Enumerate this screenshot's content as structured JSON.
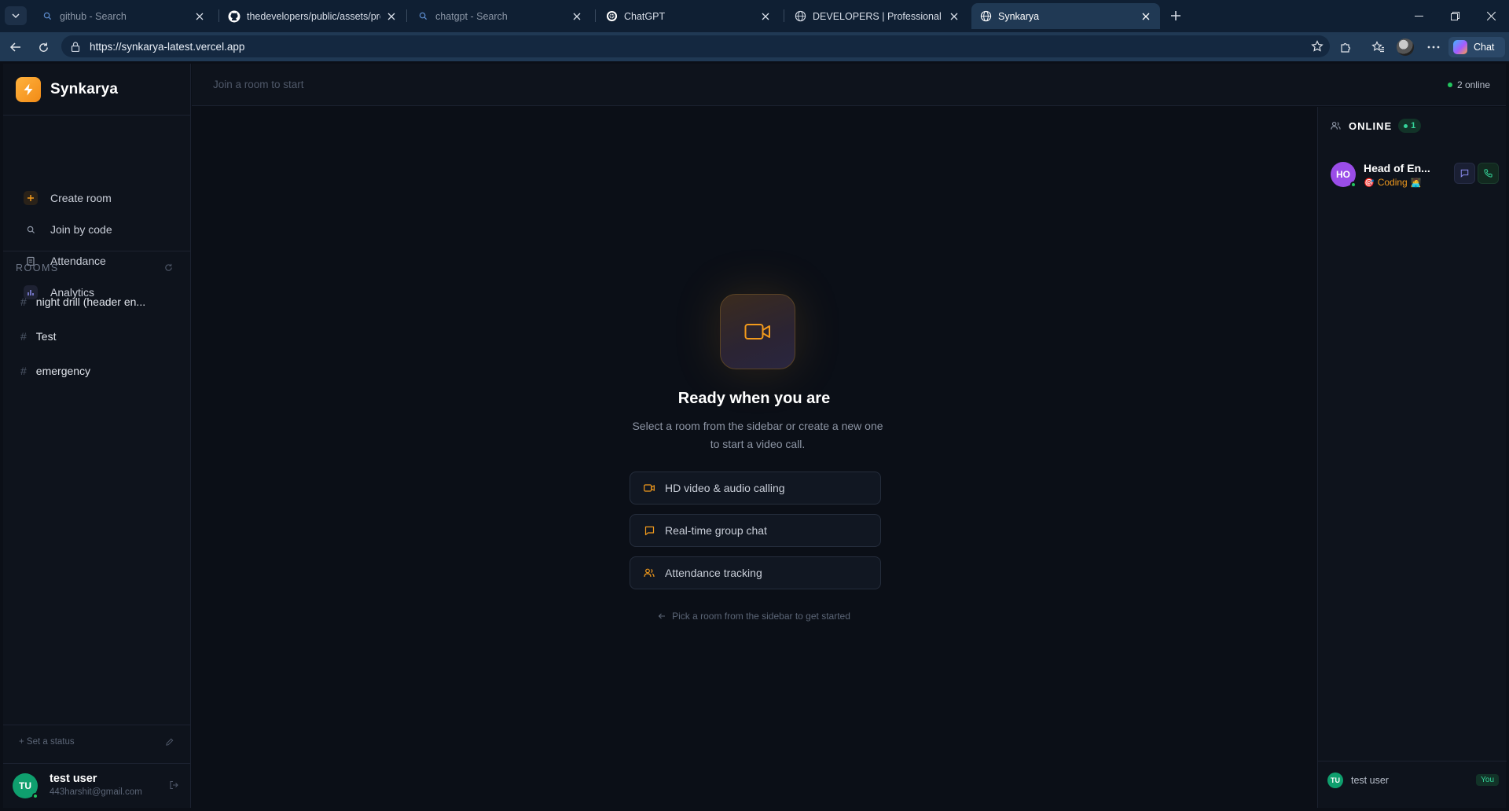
{
  "browser": {
    "tabs": [
      {
        "title": "github - Search",
        "icon": "search-icon",
        "dim": true
      },
      {
        "title": "thedevelopers/public/assets/previ",
        "icon": "github-icon",
        "dim": false
      },
      {
        "title": "chatgpt - Search",
        "icon": "search-icon",
        "dim": true
      },
      {
        "title": "ChatGPT",
        "icon": "chatgpt-icon",
        "dim": false
      },
      {
        "title": "DEVELOPERS | Professional Web &",
        "icon": "globe-icon",
        "dim": false
      },
      {
        "title": "Synkarya",
        "icon": "globe-icon",
        "dim": false,
        "active": true
      }
    ],
    "url": "https://synkarya-latest.vercel.app",
    "copilot_label": "Chat"
  },
  "app": {
    "brand": "Synkarya",
    "nav": [
      {
        "label": "Create room",
        "icon": "plus-icon"
      },
      {
        "label": "Join by code",
        "icon": "search-icon"
      },
      {
        "label": "Attendance",
        "icon": "clipboard-icon"
      },
      {
        "label": "Analytics",
        "icon": "bar-chart-icon"
      }
    ],
    "rooms_title": "ROOMS",
    "rooms": [
      {
        "name": "night drill (header en..."
      },
      {
        "name": "Test"
      },
      {
        "name": "emergency"
      }
    ],
    "set_status": "+ Set a status",
    "me": {
      "initials": "TU",
      "name": "test user",
      "email": "443harshit@gmail.com"
    },
    "topbar_hint": "Join a room to start",
    "online_count": "2 online",
    "hero": {
      "title": "Ready when you are",
      "subtitle": "Select a room from the sidebar or create a new one to start a video call."
    },
    "features": [
      {
        "label": "HD video & audio calling",
        "icon": "video-icon"
      },
      {
        "label": "Real-time group chat",
        "icon": "chat-icon"
      },
      {
        "label": "Attendance tracking",
        "icon": "users-icon"
      }
    ],
    "pick_hint": "Pick a room from the sidebar to get started",
    "online_panel": {
      "title": "ONLINE",
      "count": "1",
      "members": [
        {
          "initials": "HO",
          "name": "Head of En...",
          "status": "Coding",
          "status_emoji": "🎯",
          "status_emoji_after": "🧑‍💻"
        }
      ],
      "me": {
        "initials": "TU",
        "name": "test user",
        "badge": "You"
      }
    },
    "colors": {
      "accent": "#f29a1c",
      "online": "#22c55e",
      "background": "#0b0f17"
    }
  }
}
